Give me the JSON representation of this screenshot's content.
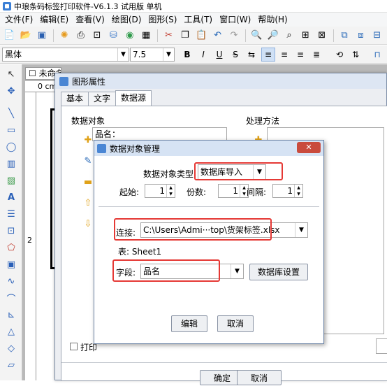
{
  "app": {
    "title": "中琅条码标签打印软件-V6.1.3 试用版 单机"
  },
  "menu": [
    "文件(F)",
    "编辑(E)",
    "查看(V)",
    "绘图(D)",
    "图形(S)",
    "工具(T)",
    "窗口(W)",
    "帮助(H)"
  ],
  "format": {
    "font": "黑体",
    "size": "7.5",
    "bold": "B",
    "italic": "I",
    "underline": "U",
    "strike": "S"
  },
  "doc": {
    "tab_title": "未命名",
    "ruler_label": "0 cm",
    "ruler_2": "2"
  },
  "prop": {
    "title": "图形属性",
    "tabs": [
      "基本",
      "文字",
      "数据源"
    ],
    "data_object_label": "数据对象",
    "data_object_value": "品名：",
    "process_label": "处理方法",
    "print_label": "打印",
    "ok": "确定",
    "cancel": "取消"
  },
  "dobj": {
    "title": "数据对象管理",
    "type_label": "数据对象类型:",
    "type_value": "数据库导入",
    "start_label": "起始:",
    "start_value": "1",
    "copies_label": "份数:",
    "copies_value": "1",
    "interval_label": "间隔:",
    "interval_value": "1",
    "conn_label": "连接:",
    "conn_value": "C:\\Users\\Admi···top\\货架标签.xlsx",
    "table_label": "表: Sheet1",
    "field_label": "字段:",
    "field_value": "品名",
    "db_settings": "数据库设置",
    "edit": "编辑",
    "cancel": "取消"
  }
}
